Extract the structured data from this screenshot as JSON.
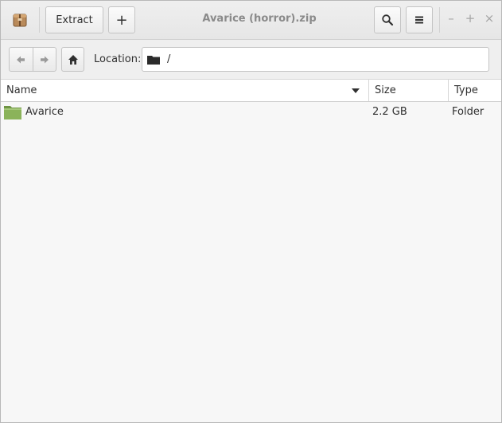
{
  "window": {
    "title": "Avarice (horror).zip",
    "controls": {
      "minimize": "–",
      "maximize": "+",
      "close": "×"
    }
  },
  "headerbar": {
    "extract_label": "Extract",
    "add_label": "+",
    "search_icon": "search-icon",
    "menu_icon": "hamburger-menu-icon"
  },
  "toolbar": {
    "location_label": "Location:",
    "location_value": "/"
  },
  "columns": [
    {
      "label": "Name"
    },
    {
      "label": "Size"
    },
    {
      "label": "Type"
    }
  ],
  "files": [
    {
      "name": "Avarice",
      "size": "2.2 GB",
      "type": "Folder"
    }
  ],
  "colors": {
    "folder_green": "#8bb35a",
    "folder_dark": "#2b2b2b",
    "title_text": "#8a8a8a"
  }
}
